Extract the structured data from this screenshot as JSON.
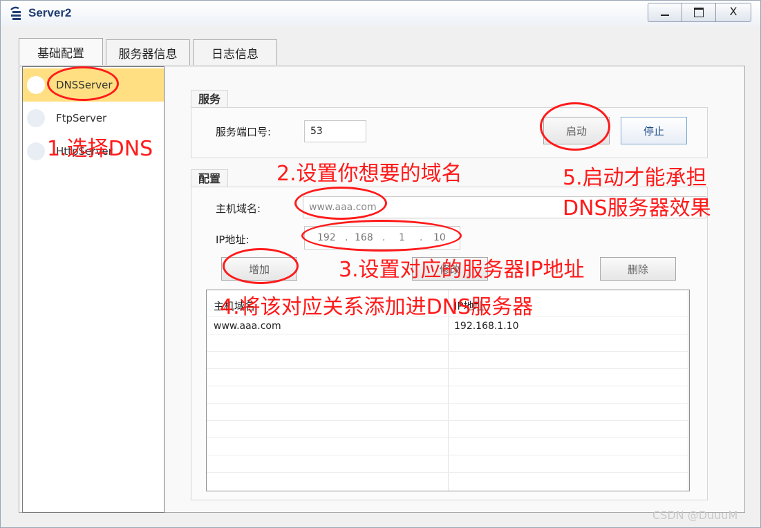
{
  "window": {
    "title": "Server2",
    "min_icon": "minimize-icon",
    "max_icon": "maximize-icon",
    "close_label": "X"
  },
  "tabs": [
    {
      "label": "基础配置"
    },
    {
      "label": "服务器信息"
    },
    {
      "label": "日志信息"
    }
  ],
  "sidebar": {
    "items": [
      {
        "label": "DNSServer"
      },
      {
        "label": "FtpServer"
      },
      {
        "label": "HttpServer"
      }
    ]
  },
  "service": {
    "title": "服务",
    "port_label": "服务端口号:",
    "port_value": "53",
    "start_label": "启动",
    "stop_label": "停止"
  },
  "config": {
    "title": "配置",
    "host_label": "主机域名:",
    "host_value": "www.aaa.com",
    "ip_label": "IP地址:",
    "ip_octets": [
      "192",
      "168",
      "1",
      "10"
    ],
    "ip_dot": ".",
    "add_label": "增加",
    "modify_label": "修改",
    "delete_label": "删除"
  },
  "table": {
    "headers": [
      "主机域名",
      "IP地址"
    ],
    "rows": [
      [
        "www.aaa.com",
        "192.168.1.10"
      ]
    ]
  },
  "annotations": {
    "a1": "1.选择DNS",
    "a2": "2.设置你想要的域名",
    "a3": "3.设置对应的服务器IP地址",
    "a4": "4.将该对应关系添加进DNS服务器",
    "a5_line1": "5.启动才能承担",
    "a5_line2": "DNS服务器效果"
  },
  "watermark": "CSDN @DuuuM",
  "colors": {
    "annotation": "#ff1a1a",
    "selected_row": "#ffdf82",
    "title_text": "#1f3c73"
  }
}
